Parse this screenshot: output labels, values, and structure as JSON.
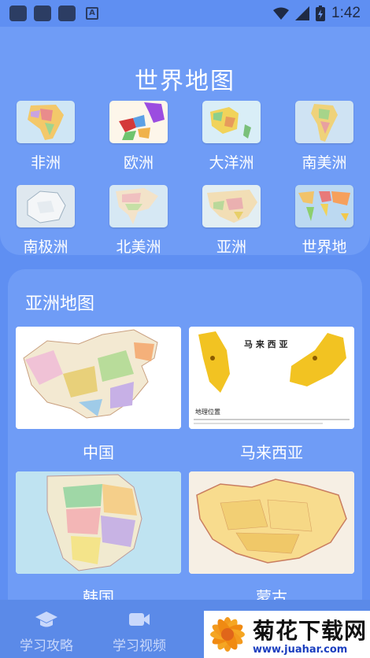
{
  "status_bar": {
    "time": "1:42"
  },
  "world": {
    "title": "世界地图",
    "continents": [
      {
        "label": "非洲"
      },
      {
        "label": "欧洲"
      },
      {
        "label": "大洋洲"
      },
      {
        "label": "南美洲"
      },
      {
        "label": "南极洲"
      },
      {
        "label": "北美洲"
      },
      {
        "label": "亚洲"
      },
      {
        "label": "世界地"
      }
    ]
  },
  "asia": {
    "title": "亚洲地图",
    "maps": [
      {
        "label": "中国"
      },
      {
        "label": "马来西亚",
        "map_heading": "马 来 西 亚",
        "map_caption": "地理位置"
      },
      {
        "label": "韩国"
      },
      {
        "label": "蒙古"
      }
    ]
  },
  "bottom_nav": {
    "items": [
      {
        "label": "学习攻略",
        "icon": "graduation-cap-icon"
      },
      {
        "label": "学习视频",
        "icon": "video-camera-icon"
      }
    ]
  },
  "watermark": {
    "name": "菊花下载网",
    "url": "www.juahar.com"
  },
  "colors": {
    "background": "#5f8ff2",
    "card": "#6f9cf6",
    "nav": "#5b8ae8"
  }
}
